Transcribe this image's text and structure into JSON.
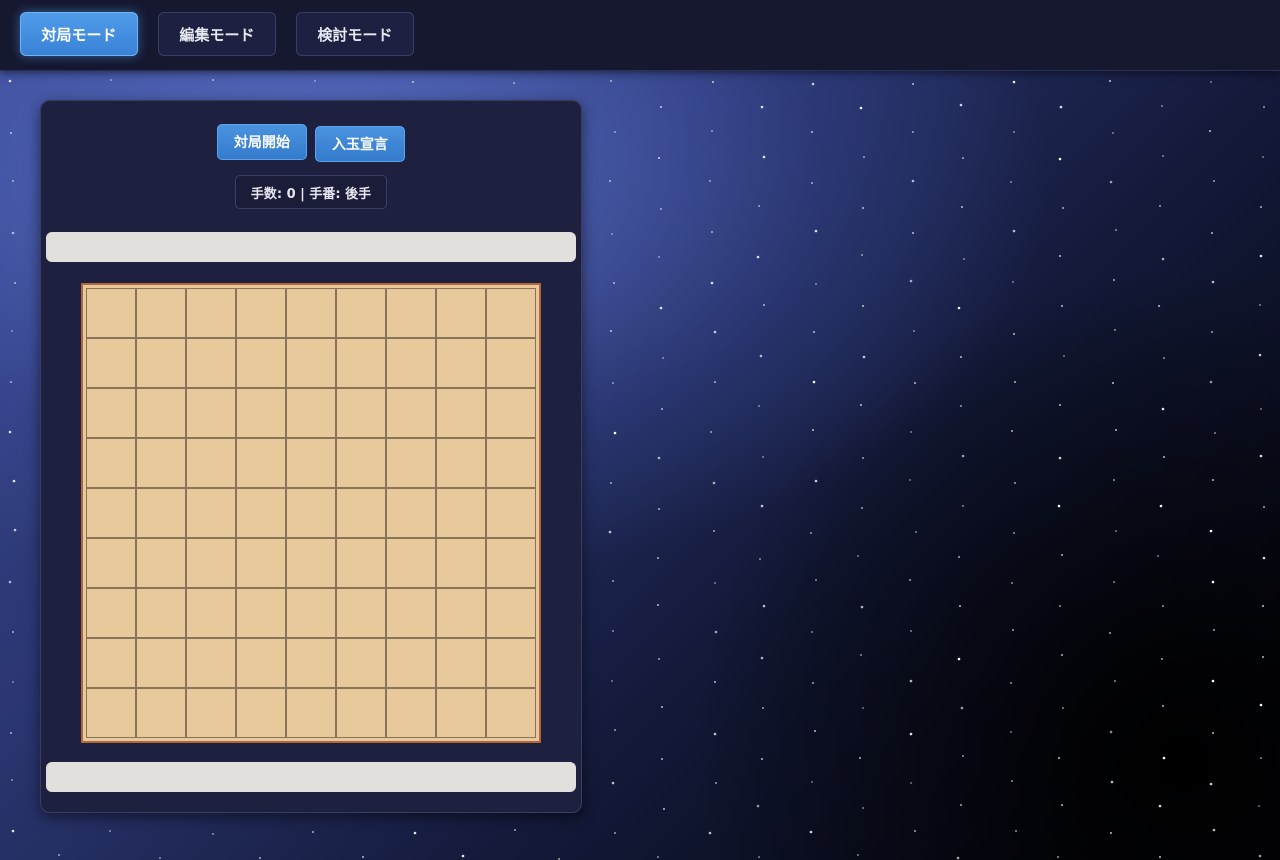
{
  "header": {
    "tabs": [
      {
        "label": "対局モード",
        "active": true
      },
      {
        "label": "編集モード",
        "active": false
      },
      {
        "label": "検討モード",
        "active": false
      }
    ]
  },
  "controls": {
    "start_game_label": "対局開始",
    "declare_label": "入玉宣言"
  },
  "status": {
    "text": "手数: 0 | 手番: 後手",
    "move_count": 0,
    "turn": "後手"
  },
  "board": {
    "files": 9,
    "ranks": 9,
    "pieces": []
  },
  "colors": {
    "accent": "#3a82d6",
    "board": "#e8c99c",
    "board_border": "#b0653a",
    "panel": "#1e2040",
    "hand_area": "#e2dfdd"
  }
}
